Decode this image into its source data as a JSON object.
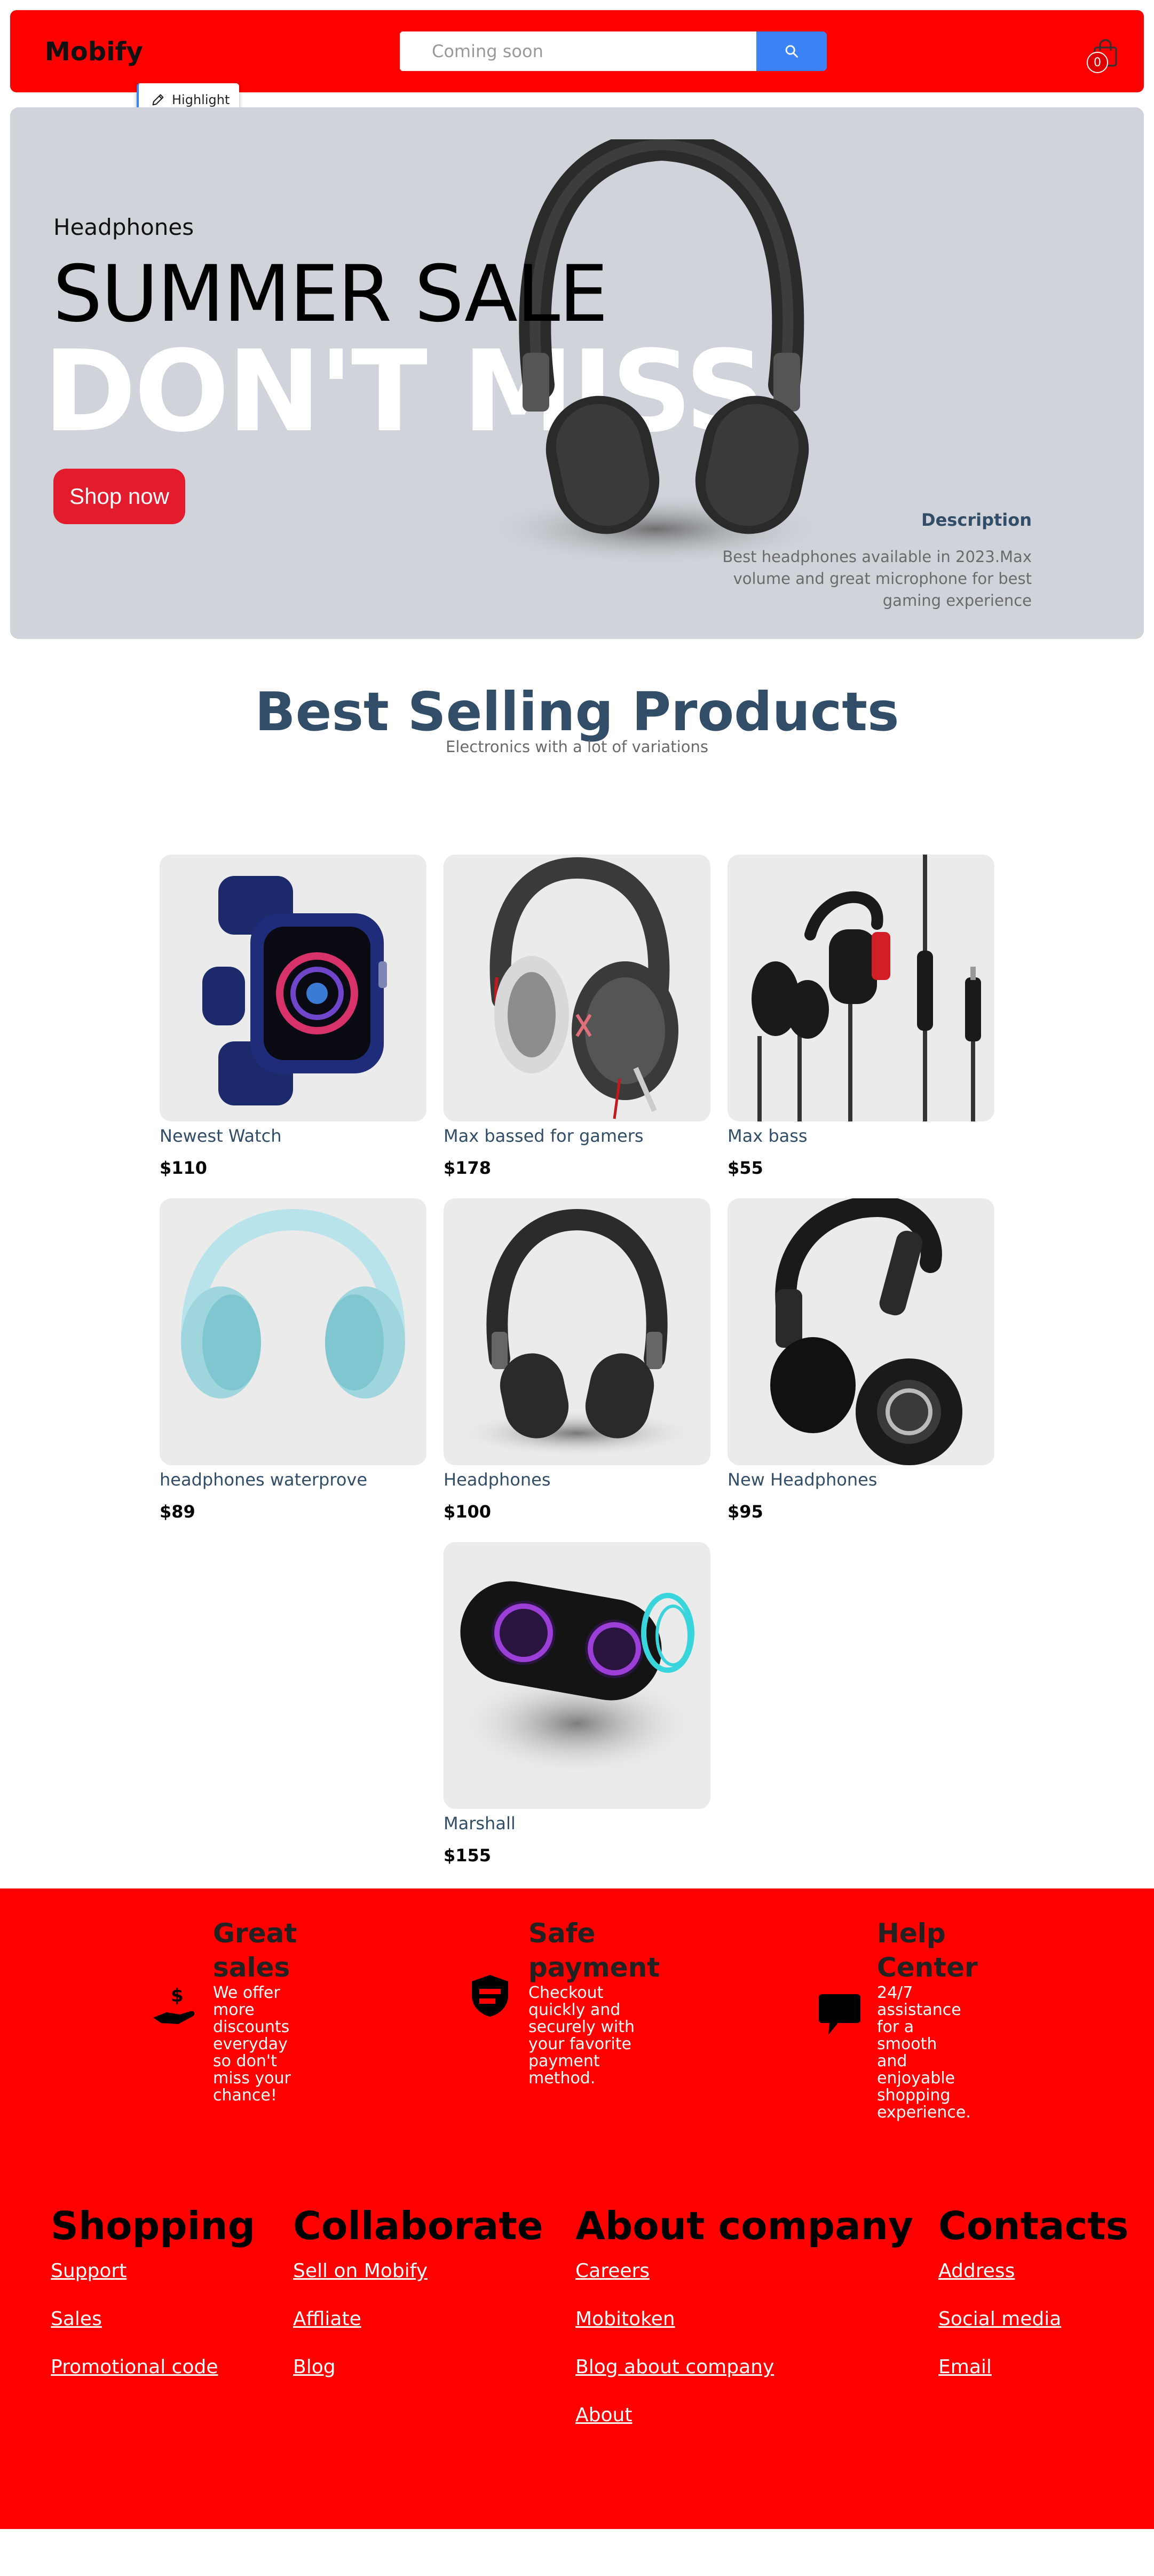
{
  "navbar": {
    "logo": "Mobify",
    "search_placeholder": "Coming soon",
    "search_icon": "search-icon",
    "cart_icon": "shopping-bag-icon",
    "cart_count": "0",
    "highlight_label": "Highlight",
    "highlight_icon": "pencil-icon"
  },
  "hero": {
    "subtitle": "Headphones",
    "title": "SUMMER SALE",
    "big_text": "DON'T MISS",
    "button": "Shop now",
    "description_title": "Description",
    "description_text": "Best headphones available in 2023.Max volume and great microphone for best gaming experience",
    "image": "headphones-black-image"
  },
  "best_selling": {
    "title": "Best Selling Products",
    "subtitle": "Electronics with a lot of variations"
  },
  "products": [
    {
      "name": "Newest Watch",
      "price": "$110",
      "image": "smart-watch-image"
    },
    {
      "name": "Max bassed for gamers",
      "price": "$178",
      "image": "gaming-headset-image"
    },
    {
      "name": "Max bass",
      "price": "$55",
      "image": "earphones-image"
    },
    {
      "name": "headphones waterprove",
      "price": "$89",
      "image": "blue-headphones-image"
    },
    {
      "name": "Headphones",
      "price": "$100",
      "image": "black-headphones-image"
    },
    {
      "name": "New Headphones",
      "price": "$95",
      "image": "boat-headphones-image"
    },
    {
      "name": "Marshall",
      "price": "$155",
      "image": "speaker-image"
    }
  ],
  "features": [
    {
      "title": "Great sales",
      "text": "We offer more discounts everyday so don't miss your chance!",
      "icon": "hand-dollar-icon"
    },
    {
      "title": "Safe payment",
      "text": "Checkout quickly and securely with your favorite payment method.",
      "icon": "shield-payment-icon"
    },
    {
      "title": "Help Center",
      "text": "24/7 assistance for a smooth and enjoyable shopping experience.",
      "icon": "chat-bubble-icon"
    }
  ],
  "footer": {
    "columns": [
      {
        "title": "Shopping",
        "links": [
          "Support",
          "Sales",
          "Promotional code"
        ]
      },
      {
        "title": "Collaborate",
        "links": [
          "Sell on Mobify",
          "Affliate",
          "Blog"
        ]
      },
      {
        "title": "About company",
        "links": [
          "Careers",
          "Mobitoken",
          "Blog about company",
          "About"
        ]
      },
      {
        "title": "Contacts",
        "links": [
          "Address",
          "Social media",
          "Email"
        ]
      }
    ]
  },
  "colors": {
    "brand_red": "#ff0000",
    "search_blue": "#3b82f6",
    "shop_button": "#e21b2d",
    "heading": "#324d67",
    "hero_bg": "#d0d4da"
  }
}
